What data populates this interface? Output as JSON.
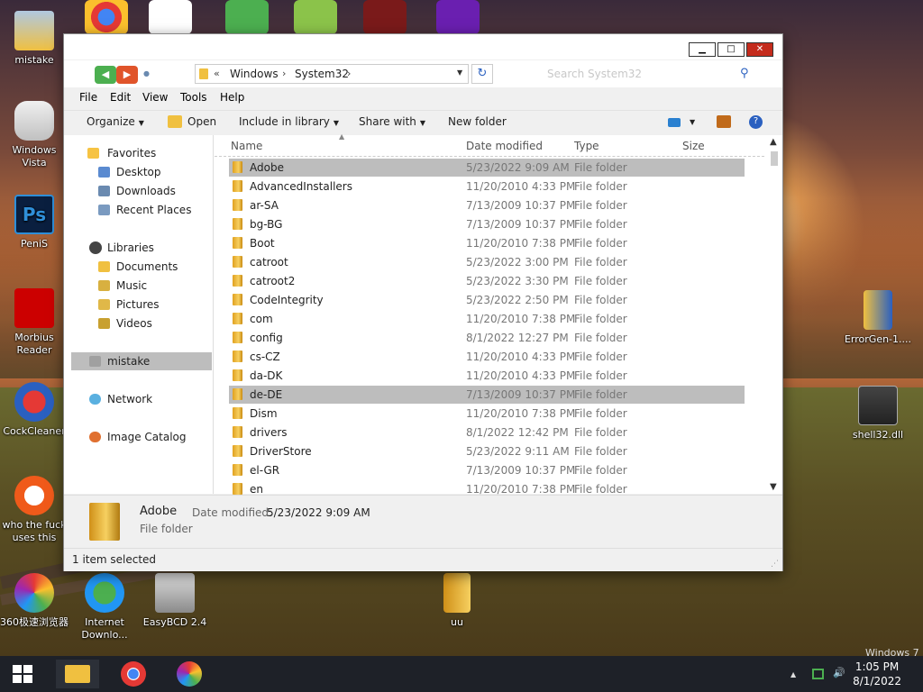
{
  "desktop": {
    "icons_left": [
      {
        "label": "mistake"
      },
      {
        "label": "Windows Vista"
      },
      {
        "label": "PeniS"
      },
      {
        "label": "Morbius Reader"
      },
      {
        "label": "CockCleaner"
      },
      {
        "label": "who the fuck uses this"
      }
    ],
    "icons_bottom": [
      {
        "label": "360极速浏览器"
      },
      {
        "label": "Internet Downlo..."
      },
      {
        "label": "EasyBCD 2.4"
      },
      {
        "label": "uu"
      }
    ],
    "icons_right": [
      {
        "label": "ErrorGen-1...."
      },
      {
        "label": "shell32.dll"
      }
    ],
    "watermark": "Windows 7"
  },
  "window": {
    "controls": {
      "minimize": "▁",
      "maximize": "□",
      "close": "✕"
    },
    "address": {
      "prefix": "«",
      "crumbs": [
        "Windows",
        "System32"
      ],
      "separator": "›"
    },
    "search_placeholder": "Search System32",
    "menu": [
      "File",
      "Edit",
      "View",
      "Tools",
      "Help"
    ],
    "toolbar": {
      "organize": "Organize",
      "open": "Open",
      "include": "Include in library",
      "share": "Share with",
      "new_folder": "New folder"
    },
    "nav": {
      "favorites": "Favorites",
      "desktop": "Desktop",
      "downloads": "Downloads",
      "recent": "Recent Places",
      "libraries": "Libraries",
      "documents": "Documents",
      "music": "Music",
      "pictures": "Pictures",
      "videos": "Videos",
      "mistake": "mistake",
      "network": "Network",
      "image_catalog": "Image Catalog"
    },
    "columns": {
      "name": "Name",
      "date": "Date modified",
      "type": "Type",
      "size": "Size"
    },
    "files": [
      {
        "name": "Adobe",
        "date": "5/23/2022 9:09 AM",
        "type": "File folder"
      },
      {
        "name": "AdvancedInstallers",
        "date": "11/20/2010 4:33 PM",
        "type": "File folder"
      },
      {
        "name": "ar-SA",
        "date": "7/13/2009 10:37 PM",
        "type": "File folder"
      },
      {
        "name": "bg-BG",
        "date": "7/13/2009 10:37 PM",
        "type": "File folder"
      },
      {
        "name": "Boot",
        "date": "11/20/2010 7:38 PM",
        "type": "File folder"
      },
      {
        "name": "catroot",
        "date": "5/23/2022 3:00 PM",
        "type": "File folder"
      },
      {
        "name": "catroot2",
        "date": "5/23/2022 3:30 PM",
        "type": "File folder"
      },
      {
        "name": "CodeIntegrity",
        "date": "5/23/2022 2:50 PM",
        "type": "File folder"
      },
      {
        "name": "com",
        "date": "11/20/2010 7:38 PM",
        "type": "File folder"
      },
      {
        "name": "config",
        "date": "8/1/2022 12:27 PM",
        "type": "File folder"
      },
      {
        "name": "cs-CZ",
        "date": "11/20/2010 4:33 PM",
        "type": "File folder"
      },
      {
        "name": "da-DK",
        "date": "11/20/2010 4:33 PM",
        "type": "File folder"
      },
      {
        "name": "de-DE",
        "date": "7/13/2009 10:37 PM",
        "type": "File folder"
      },
      {
        "name": "Dism",
        "date": "11/20/2010 7:38 PM",
        "type": "File folder"
      },
      {
        "name": "drivers",
        "date": "8/1/2022 12:42 PM",
        "type": "File folder"
      },
      {
        "name": "DriverStore",
        "date": "5/23/2022 9:11 AM",
        "type": "File folder"
      },
      {
        "name": "el-GR",
        "date": "7/13/2009 10:37 PM",
        "type": "File folder"
      },
      {
        "name": "en",
        "date": "11/20/2010 7:38 PM",
        "type": "File folder"
      }
    ],
    "details": {
      "name": "Adobe",
      "type": "File folder",
      "date_label": "Date modified:",
      "date_value": "5/23/2022 9:09 AM"
    },
    "status": "1 item selected"
  },
  "taskbar": {
    "time": "1:05 PM",
    "date": "8/1/2022",
    "tray_arrow": "▲",
    "volume_icon": "🔊"
  },
  "colors": {
    "selection": "#bdbdbd",
    "close_button": "#c42b1c",
    "folder": "#f0c040",
    "taskbar": "#1e2128"
  }
}
